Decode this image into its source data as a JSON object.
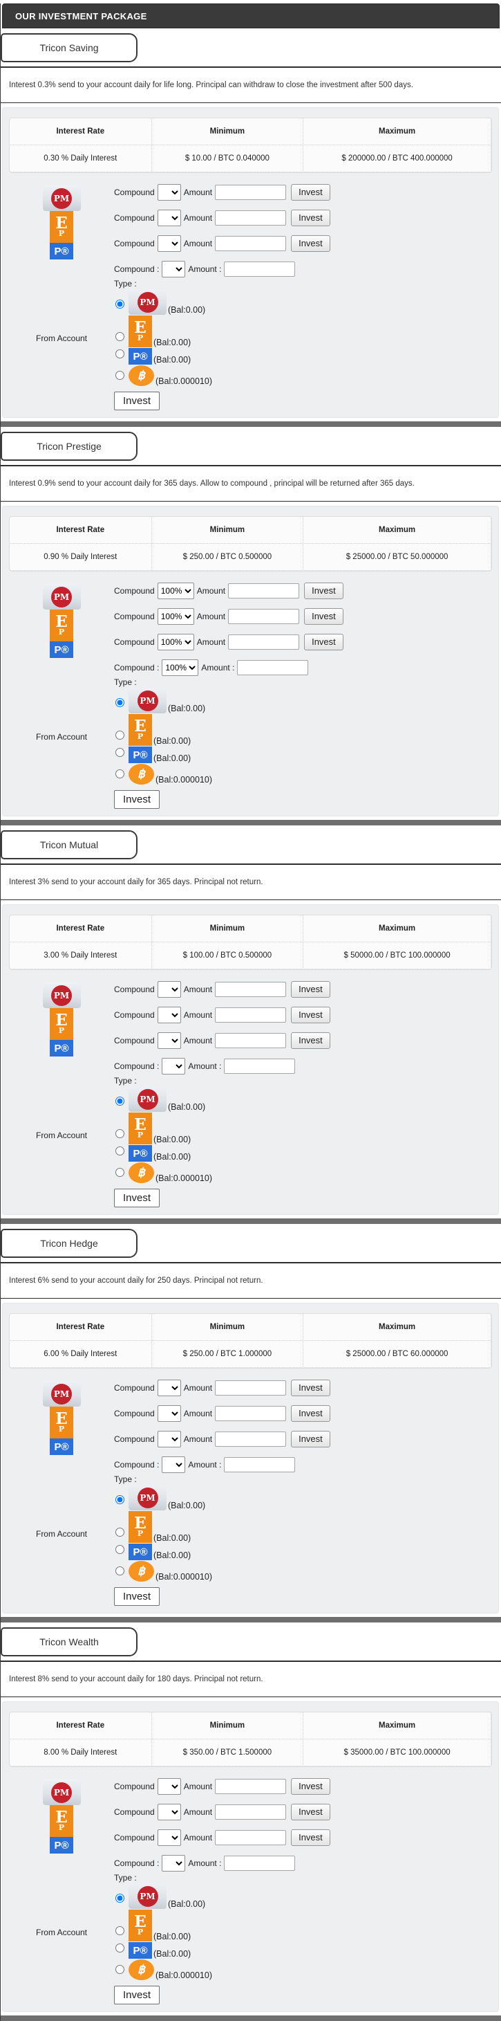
{
  "header": {
    "title": "OUR INVESTMENT PACKAGE"
  },
  "table_headers": [
    "Interest Rate",
    "Minimum",
    "Maximum"
  ],
  "form_labels": {
    "compound": "Compound",
    "amount": "Amount",
    "compound_colon": "Compound :",
    "amount_colon": "Amount :",
    "type": "Type :",
    "from_account": "From Account",
    "invest": "Invest"
  },
  "accounts": [
    {
      "name": "perfect-money",
      "icon_text": "PM",
      "balance": "(Bal:0.00)"
    },
    {
      "name": "epaycore",
      "icon_main": "E",
      "icon_sub": "P",
      "balance": "(Bal:0.00)"
    },
    {
      "name": "payeer",
      "icon_text": "P®",
      "balance": "(Bal:0.00)"
    },
    {
      "name": "bitcoin",
      "icon_text": "฿",
      "balance": "(Bal:0.000010)"
    }
  ],
  "colors": {
    "header_bar": "#3a3a3a",
    "divider": "#6e6e6e",
    "perfect_money_red": "#c2222b",
    "epaycore_orange": "#f08a17",
    "payeer_blue": "#2b6fd9",
    "bitcoin_orange": "#f7941d"
  },
  "packages": [
    {
      "name": "Tricon Saving",
      "description": "Interest 0.3% send to your account daily for life long. Principal can withdraw to close the investment after 500 days.",
      "interest_rate": "0.30 % Daily Interest",
      "minimum": "$ 10.00 / BTC 0.040000",
      "maximum": "$ 200000.00 / BTC 400.000000",
      "compound_value": ""
    },
    {
      "name": "Tricon Prestige",
      "description": "Interest 0.9% send to your account daily for 365 days. Allow to compound , principal will be returned after 365 days.",
      "interest_rate": "0.90 % Daily Interest",
      "minimum": "$ 250.00 / BTC 0.500000",
      "maximum": "$ 25000.00 / BTC 50.000000",
      "compound_value": "100%"
    },
    {
      "name": "Tricon Mutual",
      "description": "Interest 3% send to your account daily for 365 days. Principal not return.",
      "interest_rate": "3.00 % Daily Interest",
      "minimum": "$ 100.00 / BTC 0.500000",
      "maximum": "$ 50000.00 / BTC 100.000000",
      "compound_value": ""
    },
    {
      "name": "Tricon Hedge",
      "description": "Interest 6% send to your account daily for 250 days. Principal not return.",
      "interest_rate": "6.00 % Daily Interest",
      "minimum": "$ 250.00 / BTC 1.000000",
      "maximum": "$ 25000.00 / BTC 60.000000",
      "compound_value": ""
    },
    {
      "name": "Tricon Wealth",
      "description": "Interest 8% send to your account daily for 180 days. Principal not return.",
      "interest_rate": "8.00 % Daily Interest",
      "minimum": "$ 350.00 / BTC 1.500000",
      "maximum": "$ 35000.00 / BTC 100.000000",
      "compound_value": ""
    }
  ]
}
